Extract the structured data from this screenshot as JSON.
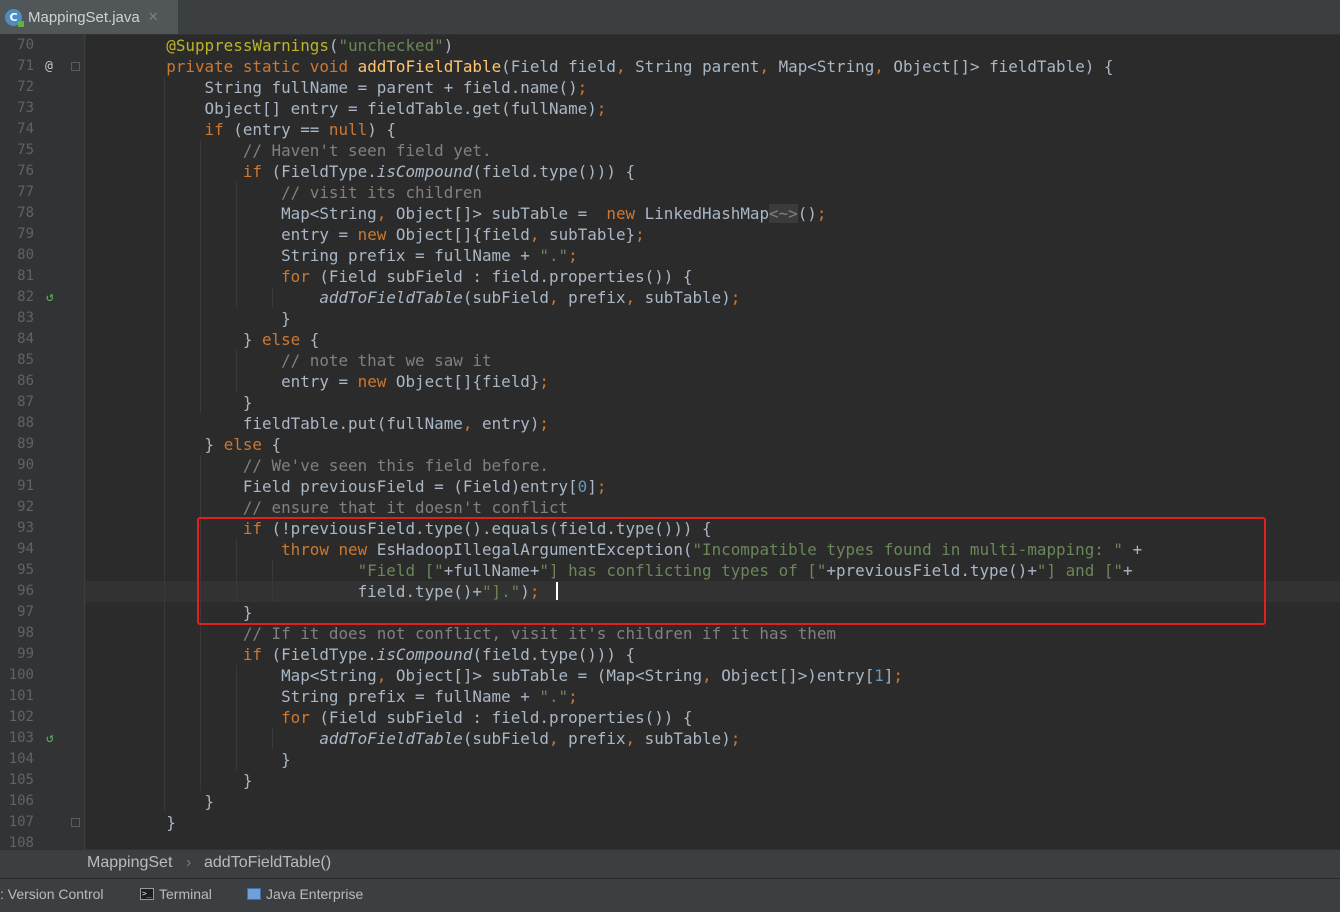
{
  "tab": {
    "title": "MappingSet.java",
    "icon_letter": "C",
    "close_glyph": "✕"
  },
  "breadcrumb": {
    "class_name": "MappingSet",
    "separator": "›",
    "method": "addToFieldTable()"
  },
  "statusbar": {
    "version_control": ": Version Control",
    "terminal": "Terminal",
    "java_enterprise": "Java Enterprise",
    "terminal_glyph": ">_"
  },
  "gutter_icons": {
    "override_glyph": "@",
    "recursive_call_glyph": "↺"
  },
  "code_lines": [
    {
      "n": "70",
      "indent": 1,
      "t": [
        [
          "ann",
          "@SuppressWarnings"
        ],
        [
          "p",
          "("
        ],
        [
          "str",
          "\"unchecked\""
        ],
        [
          "p",
          ")"
        ]
      ]
    },
    {
      "n": "71",
      "indent": 1,
      "t": [
        [
          "kw",
          "private static void "
        ],
        [
          "fn",
          "addToFieldTable"
        ],
        [
          "p",
          "(Field field"
        ],
        [
          "kw",
          ", "
        ],
        [
          "p",
          "String parent"
        ],
        [
          "kw",
          ", "
        ],
        [
          "p",
          "Map<String"
        ],
        [
          "kw",
          ", "
        ],
        [
          "p",
          "Object[]> fieldTable) {"
        ]
      ]
    },
    {
      "n": "72",
      "indent": 2,
      "t": [
        [
          "p",
          "String fullName = parent + field.name()"
        ],
        [
          "kw",
          ";"
        ]
      ]
    },
    {
      "n": "73",
      "indent": 2,
      "t": [
        [
          "p",
          "Object[] entry = fieldTable.get(fullName)"
        ],
        [
          "kw",
          ";"
        ]
      ]
    },
    {
      "n": "74",
      "indent": 2,
      "t": [
        [
          "kw",
          "if "
        ],
        [
          "p",
          "(entry == "
        ],
        [
          "kw",
          "null"
        ],
        [
          "p",
          ") {"
        ]
      ]
    },
    {
      "n": "75",
      "indent": 3,
      "t": [
        [
          "cmt",
          "// Haven't seen field yet."
        ]
      ]
    },
    {
      "n": "76",
      "indent": 3,
      "t": [
        [
          "kw",
          "if "
        ],
        [
          "p",
          "(FieldType."
        ],
        [
          "it",
          "isCompound"
        ],
        [
          "p",
          "(field.type())) {"
        ]
      ]
    },
    {
      "n": "77",
      "indent": 4,
      "t": [
        [
          "cmt",
          "// visit its children"
        ]
      ]
    },
    {
      "n": "78",
      "indent": 4,
      "t": [
        [
          "p",
          "Map<String"
        ],
        [
          "kw",
          ", "
        ],
        [
          "p",
          "Object[]> subTable =  "
        ],
        [
          "kw",
          "new "
        ],
        [
          "p",
          "LinkedHashMap"
        ],
        [
          "dia",
          "<~>"
        ],
        [
          "p",
          "()"
        ],
        [
          "kw",
          ";"
        ]
      ]
    },
    {
      "n": "79",
      "indent": 4,
      "t": [
        [
          "p",
          "entry = "
        ],
        [
          "kw",
          "new "
        ],
        [
          "p",
          "Object[]{field"
        ],
        [
          "kw",
          ", "
        ],
        [
          "p",
          "subTable}"
        ],
        [
          "kw",
          ";"
        ]
      ]
    },
    {
      "n": "80",
      "indent": 4,
      "t": [
        [
          "p",
          "String prefix = fullName + "
        ],
        [
          "str",
          "\".\""
        ],
        [
          "kw",
          ";"
        ]
      ]
    },
    {
      "n": "81",
      "indent": 4,
      "t": [
        [
          "kw",
          "for "
        ],
        [
          "p",
          "(Field subField : field.properties()) {"
        ]
      ]
    },
    {
      "n": "82",
      "indent": 5,
      "t": [
        [
          "it",
          "addToFieldTable"
        ],
        [
          "p",
          "(subField"
        ],
        [
          "kw",
          ", "
        ],
        [
          "p",
          "prefix"
        ],
        [
          "kw",
          ", "
        ],
        [
          "p",
          "subTable)"
        ],
        [
          "kw",
          ";"
        ]
      ]
    },
    {
      "n": "83",
      "indent": 4,
      "t": [
        [
          "p",
          "}"
        ]
      ]
    },
    {
      "n": "84",
      "indent": 3,
      "t": [
        [
          "p",
          "} "
        ],
        [
          "kw",
          "else "
        ],
        [
          "p",
          "{"
        ]
      ]
    },
    {
      "n": "85",
      "indent": 4,
      "t": [
        [
          "cmt",
          "// note that we saw it"
        ]
      ]
    },
    {
      "n": "86",
      "indent": 4,
      "t": [
        [
          "p",
          "entry = "
        ],
        [
          "kw",
          "new "
        ],
        [
          "p",
          "Object[]{field}"
        ],
        [
          "kw",
          ";"
        ]
      ]
    },
    {
      "n": "87",
      "indent": 3,
      "t": [
        [
          "p",
          "}"
        ]
      ]
    },
    {
      "n": "88",
      "indent": 3,
      "t": [
        [
          "p",
          "fieldTable.put(fullName"
        ],
        [
          "kw",
          ", "
        ],
        [
          "p",
          "entry)"
        ],
        [
          "kw",
          ";"
        ]
      ]
    },
    {
      "n": "89",
      "indent": 2,
      "t": [
        [
          "p",
          "} "
        ],
        [
          "kw",
          "else "
        ],
        [
          "p",
          "{"
        ]
      ]
    },
    {
      "n": "90",
      "indent": 3,
      "t": [
        [
          "cmt",
          "// We've seen this field before."
        ]
      ]
    },
    {
      "n": "91",
      "indent": 3,
      "t": [
        [
          "p",
          "Field previousField = (Field)entry["
        ],
        [
          "num",
          "0"
        ],
        [
          "p",
          "]"
        ],
        [
          "kw",
          ";"
        ]
      ]
    },
    {
      "n": "92",
      "indent": 3,
      "t": [
        [
          "cmt",
          "// ensure that it doesn't conflict"
        ]
      ]
    },
    {
      "n": "93",
      "indent": 3,
      "t": [
        [
          "kw",
          "if "
        ],
        [
          "p",
          "(!previousField.type().equals(field.type())) {"
        ]
      ]
    },
    {
      "n": "94",
      "indent": 4,
      "t": [
        [
          "kw",
          "throw new "
        ],
        [
          "p",
          "EsHadoopIllegalArgumentException("
        ],
        [
          "str",
          "\"Incompatible types found in multi-mapping: \" "
        ],
        [
          "p",
          "+"
        ]
      ]
    },
    {
      "n": "95",
      "indent": 6,
      "t": [
        [
          "str",
          "\"Field [\""
        ],
        [
          "p",
          "+fullName+"
        ],
        [
          "str",
          "\"] has conflicting types of [\""
        ],
        [
          "p",
          "+previousField.type()+"
        ],
        [
          "str",
          "\"] and [\""
        ],
        [
          "p",
          "+"
        ]
      ]
    },
    {
      "n": "96",
      "indent": 6,
      "t": [
        [
          "p",
          "field.type()+"
        ],
        [
          "str",
          "\"].\""
        ],
        [
          "p",
          ")"
        ],
        [
          "kw",
          ";"
        ]
      ]
    },
    {
      "n": "97",
      "indent": 3,
      "t": [
        [
          "p",
          "}"
        ]
      ]
    },
    {
      "n": "98",
      "indent": 3,
      "t": [
        [
          "cmt",
          "// If it does not conflict, visit it's children if it has them"
        ]
      ]
    },
    {
      "n": "99",
      "indent": 3,
      "t": [
        [
          "kw",
          "if "
        ],
        [
          "p",
          "(FieldType."
        ],
        [
          "it",
          "isCompound"
        ],
        [
          "p",
          "(field.type())) {"
        ]
      ]
    },
    {
      "n": "100",
      "indent": 4,
      "t": [
        [
          "p",
          "Map<String"
        ],
        [
          "kw",
          ", "
        ],
        [
          "p",
          "Object[]> subTable = (Map<String"
        ],
        [
          "kw",
          ", "
        ],
        [
          "p",
          "Object[]>)entry["
        ],
        [
          "num",
          "1"
        ],
        [
          "p",
          "]"
        ],
        [
          "kw",
          ";"
        ]
      ]
    },
    {
      "n": "101",
      "indent": 4,
      "t": [
        [
          "p",
          "String prefix = fullName + "
        ],
        [
          "str",
          "\".\""
        ],
        [
          "kw",
          ";"
        ]
      ]
    },
    {
      "n": "102",
      "indent": 4,
      "t": [
        [
          "kw",
          "for "
        ],
        [
          "p",
          "(Field subField : field.properties()) {"
        ]
      ]
    },
    {
      "n": "103",
      "indent": 5,
      "t": [
        [
          "it",
          "addToFieldTable"
        ],
        [
          "p",
          "(subField"
        ],
        [
          "kw",
          ", "
        ],
        [
          "p",
          "prefix"
        ],
        [
          "kw",
          ", "
        ],
        [
          "p",
          "subTable)"
        ],
        [
          "kw",
          ";"
        ]
      ]
    },
    {
      "n": "104",
      "indent": 4,
      "t": [
        [
          "p",
          "}"
        ]
      ]
    },
    {
      "n": "105",
      "indent": 3,
      "t": [
        [
          "p",
          "}"
        ]
      ]
    },
    {
      "n": "106",
      "indent": 2,
      "t": [
        [
          "p",
          "}"
        ]
      ]
    },
    {
      "n": "107",
      "indent": 1,
      "t": [
        [
          "p",
          "}"
        ]
      ]
    },
    {
      "n": "108",
      "indent": 0,
      "t": []
    }
  ],
  "colors": {
    "editor_bg": "#2b2b2b",
    "keyword": "#cc7832",
    "string": "#6a8759",
    "comment": "#808080",
    "annotation": "#bbb529",
    "method_decl": "#ffc66d",
    "number": "#6897bb",
    "plain": "#a9b7c6",
    "highlight_box": "#e0201c"
  }
}
